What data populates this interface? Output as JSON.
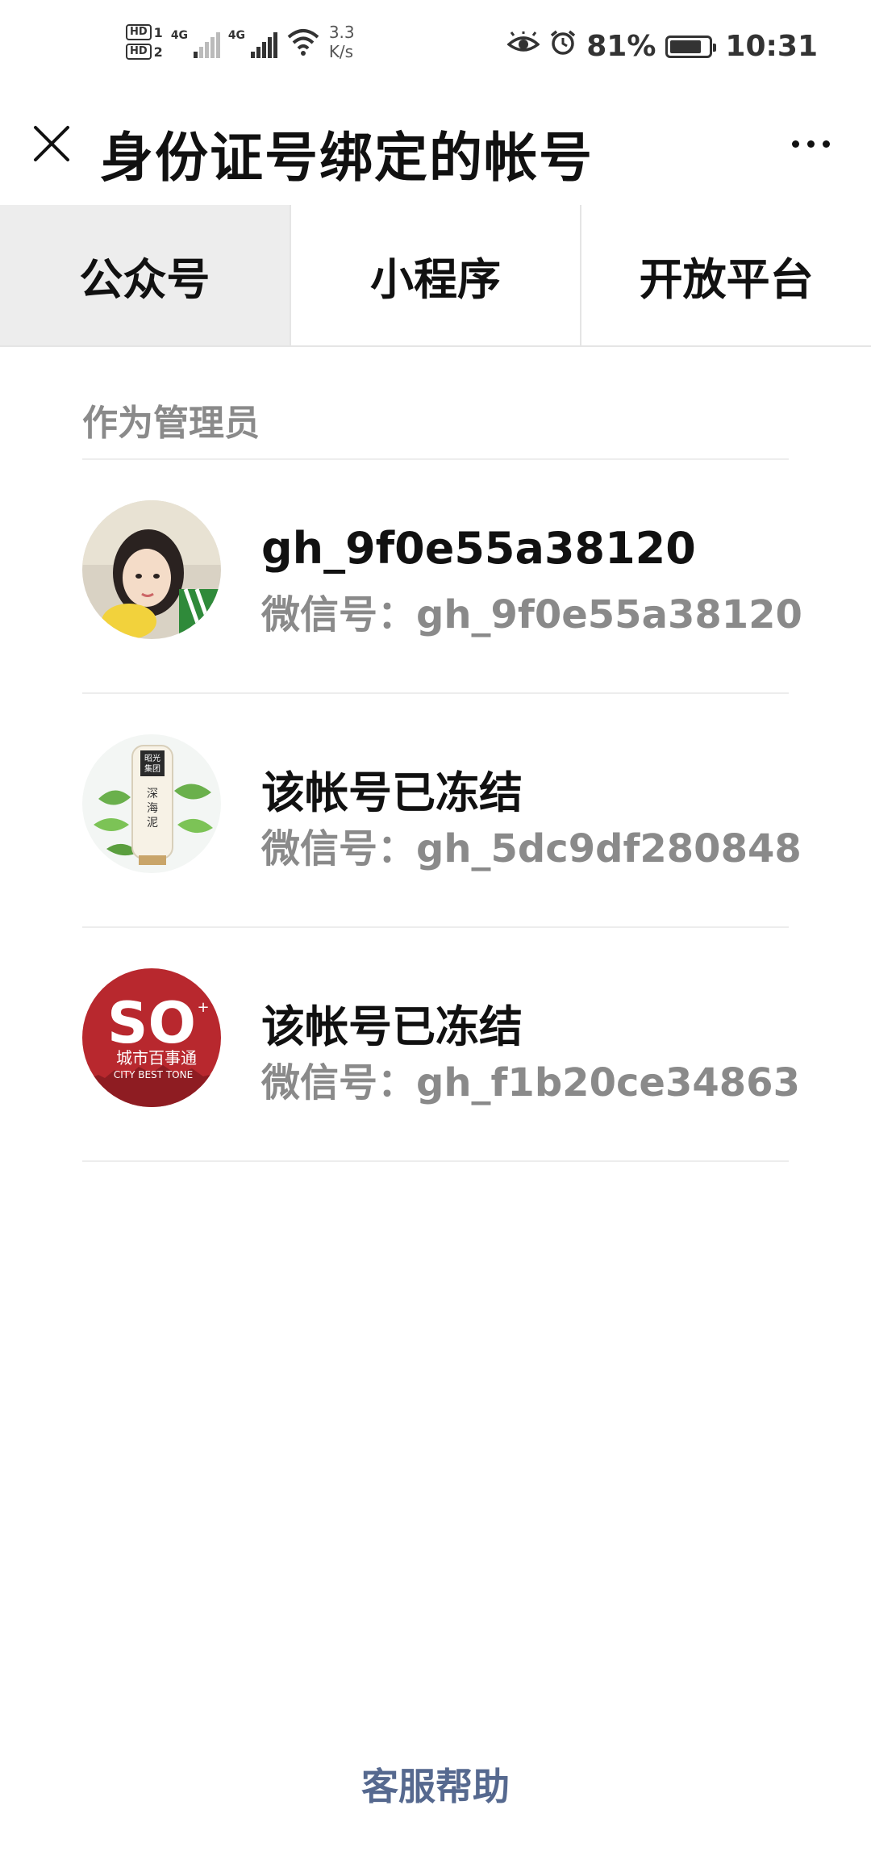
{
  "status_bar": {
    "hd1": "HD",
    "hd1_sub": "1",
    "hd2": "HD",
    "hd2_sub": "2",
    "net1": "4G",
    "net2": "4G",
    "speed_value": "3.3",
    "speed_unit": "K/s",
    "battery_text": "81%",
    "battery_level": 0.81,
    "time": "10:31"
  },
  "header": {
    "title": "身份证号绑定的帐号"
  },
  "tabs": [
    {
      "label": "公众号",
      "active": true
    },
    {
      "label": "小程序",
      "active": false
    },
    {
      "label": "开放平台",
      "active": false
    }
  ],
  "section_label": "作为管理员",
  "accounts": [
    {
      "name": "gh_9f0e55a38120",
      "wechat_id": "微信号：gh_9f0e55a38120"
    },
    {
      "name": "该帐号已冻结",
      "wechat_id": "微信号：gh_5dc9df280848"
    },
    {
      "name": "该帐号已冻结",
      "wechat_id": "微信号：gh_f1b20ce34863"
    }
  ],
  "avatar3_text": {
    "big": "SO",
    "cn": "城市百事通",
    "en": "CITY BEST TONE"
  },
  "avatar2_text": {
    "box": "昭光集团",
    "tube": "深海泥"
  },
  "footer": {
    "help_label": "客服帮助"
  }
}
